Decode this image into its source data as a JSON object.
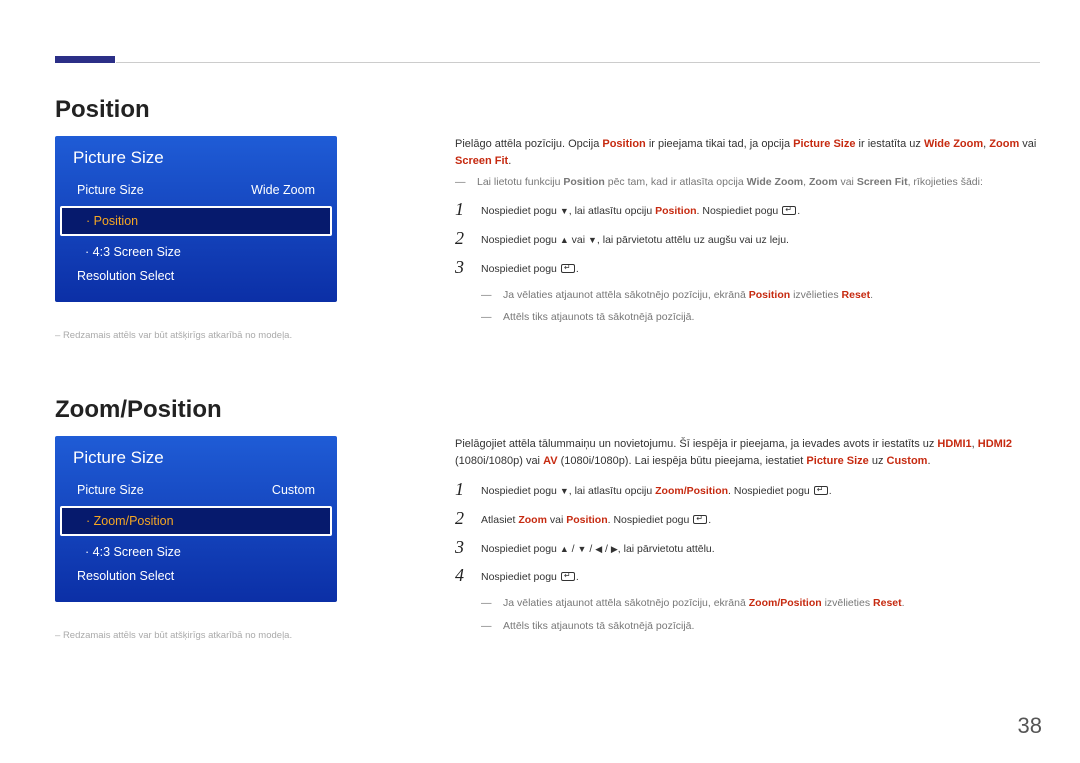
{
  "page_number": "38",
  "section1": {
    "heading": "Position",
    "menu": {
      "title": "Picture Size",
      "row1_label": "Picture Size",
      "row1_value": "Wide Zoom",
      "highlight": "Position",
      "row3": "4:3 Screen Size",
      "row4": "Resolution Select"
    },
    "footnote": "Redzamais attēls var būt atšķirīgs atkarībā no modeļa.",
    "intro_a": "Pielāgo attēla pozīciju. Opcija ",
    "intro_b": " ir pieejama tikai tad, ja opcija ",
    "intro_c": " ir iestatīta uz ",
    "kw_position": "Position",
    "kw_picsize": "Picture Size",
    "kw_widezoom": "Wide Zoom",
    "kw_zoom": "Zoom",
    "kw_screenfit": "Screen Fit",
    "dash1_a": "Lai lietotu funkciju ",
    "dash1_b": " pēc tam, kad ir atlasīta opcija ",
    "dash1_c": " vai ",
    "dash1_d": ", rīkojieties šādi:",
    "step1_a": "Nospiediet pogu ",
    "step1_b": ", lai atlasītu opciju ",
    "step1_c": ". Nospiediet pogu ",
    "step2_a": "Nospiediet pogu ",
    "step2_b": " vai ",
    "step2_c": ", lai pārvietotu attēlu uz augšu vai uz leju.",
    "step3_a": "Nospiediet pogu ",
    "note1_a": "Ja vēlaties atjaunot attēla sākotnējo pozīciju, ekrānā ",
    "note1_b": " izvēlieties ",
    "note1_c": ".",
    "kw_reset": "Reset",
    "note2": "Attēls tiks atjaunots tā sākotnējā pozīcijā."
  },
  "section2": {
    "heading": "Zoom/Position",
    "menu": {
      "title": "Picture Size",
      "row1_label": "Picture Size",
      "row1_value": "Custom",
      "highlight": "Zoom/Position",
      "row3": "4:3 Screen Size",
      "row4": "Resolution Select"
    },
    "footnote": "Redzamais attēls var būt atšķirīgs atkarībā no modeļa.",
    "intro_a": "Pielāgojiet attēla tālummaiņu un novietojumu. Šī iespēja ir pieejama, ja ievades avots ir iestatīts uz ",
    "intro_b": " (1080i/1080p) vai ",
    "intro_c": " (1080i/1080p). Lai iespēja būtu pieejama, iestatiet ",
    "intro_d": " uz ",
    "intro_e": ".",
    "kw_hdmi1": "HDMI1",
    "kw_hdmi2": "HDMI2",
    "kw_av": "AV",
    "kw_custom": "Custom",
    "kw_picsize": "Picture Size",
    "kw_zoompos": "Zoom/Position",
    "kw_zoom": "Zoom",
    "kw_position": "Position",
    "step1_a": "Nospiediet pogu ",
    "step1_b": ", lai atlasītu opciju ",
    "step1_c": ". Nospiediet pogu ",
    "step2_a": "Atlasiet ",
    "step2_b": " vai ",
    "step2_c": ". Nospiediet pogu ",
    "step3_a": "Nospiediet pogu ",
    "step3_b": ", lai pārvietotu attēlu.",
    "step4_a": "Nospiediet pogu ",
    "note1_a": "Ja vēlaties atjaunot attēla sākotnējo pozīciju, ekrānā ",
    "note1_b": " izvēlieties ",
    "note1_c": ".",
    "kw_reset": "Reset",
    "note2": "Attēls tiks atjaunots tā sākotnējā pozīcijā."
  }
}
